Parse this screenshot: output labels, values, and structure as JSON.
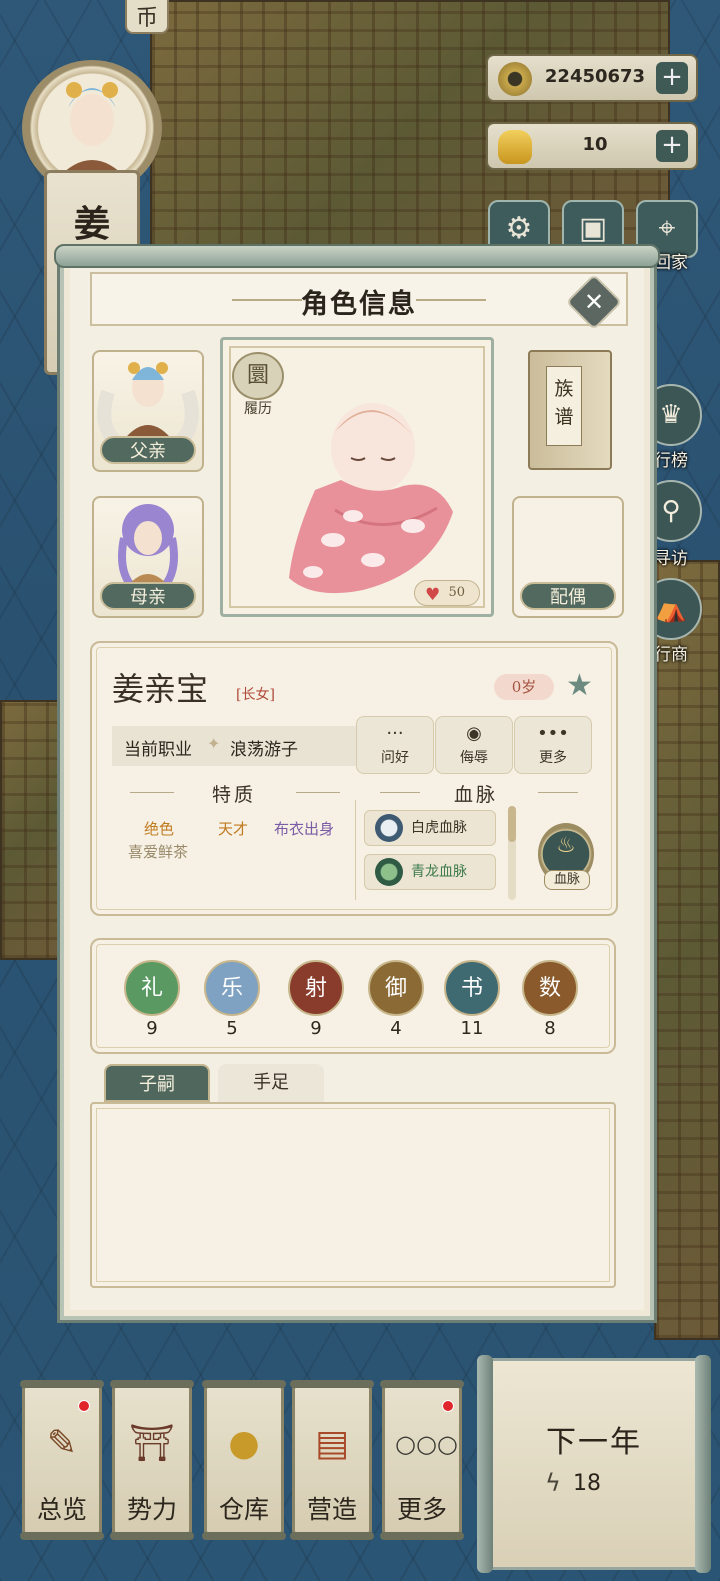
{
  "top_tag": "币",
  "player_surname": "姜",
  "resources": {
    "copper_coins": "22450673",
    "gold_ingots": "10"
  },
  "hud": {
    "settings_icon": "gear-icon",
    "save_icon": "floppy-icon",
    "location_icon": "map-pin-icon",
    "home_label": "回家"
  },
  "side": {
    "leaderboard_label": "行榜",
    "search_label": "寻访",
    "merchant_label": "行商"
  },
  "panel": {
    "title": "角色信息",
    "close_symbol": "✕",
    "father_label": "父亲",
    "mother_label": "母亲",
    "resume_label": "履历",
    "resume_icon_text": "圜",
    "affection": "50",
    "genealogy_label": "族谱",
    "spouse_label": "配偶"
  },
  "character": {
    "name": "姜亲宝",
    "rank": "[长女]",
    "age": "0岁",
    "job_key": "当前职业",
    "job_value": "浪荡游子"
  },
  "actions": [
    {
      "label": "问好",
      "icon": "chat-bubble-icon",
      "glyph": "···"
    },
    {
      "label": "侮辱",
      "icon": "angry-face-icon",
      "glyph": "◉"
    },
    {
      "label": "更多",
      "icon": "more-dots-icon",
      "glyph": "•••"
    }
  ],
  "traits": {
    "title": "特质",
    "items": [
      "绝色",
      "天才",
      "布衣出身",
      "喜爱鲜茶"
    ],
    "colors": [
      "#c07a1e",
      "#c07a1e",
      "#7b5aa6",
      "#9a8a6a"
    ]
  },
  "bloodline": {
    "title": "血脉",
    "items": [
      "白虎血脉",
      "青龙血脉"
    ],
    "button_label": "血脉"
  },
  "skills": [
    {
      "name": "礼",
      "value": "9",
      "color": "#5a9a62"
    },
    {
      "name": "乐",
      "value": "5",
      "color": "#7fa2c2"
    },
    {
      "name": "射",
      "value": "9",
      "color": "#8a3c2c"
    },
    {
      "name": "御",
      "value": "4",
      "color": "#8c6a36"
    },
    {
      "name": "书",
      "value": "11",
      "color": "#3f6a72"
    },
    {
      "name": "数",
      "value": "8",
      "color": "#8a5a2c"
    }
  ],
  "tabs": [
    "子嗣",
    "手足"
  ],
  "dock": [
    {
      "label": "总览",
      "icon": "overview-scroll-icon",
      "glyph": "📜"
    },
    {
      "label": "势力",
      "icon": "palace-icon",
      "glyph": "⛩"
    },
    {
      "label": "仓库",
      "icon": "money-bag-icon",
      "glyph": "💰"
    },
    {
      "label": "营造",
      "icon": "trowel-bricks-icon",
      "glyph": "🧱"
    },
    {
      "label": "更多",
      "icon": "more-circles-icon",
      "glyph": "○○○"
    }
  ],
  "next_year": {
    "label": "下一年",
    "energy": "18"
  }
}
